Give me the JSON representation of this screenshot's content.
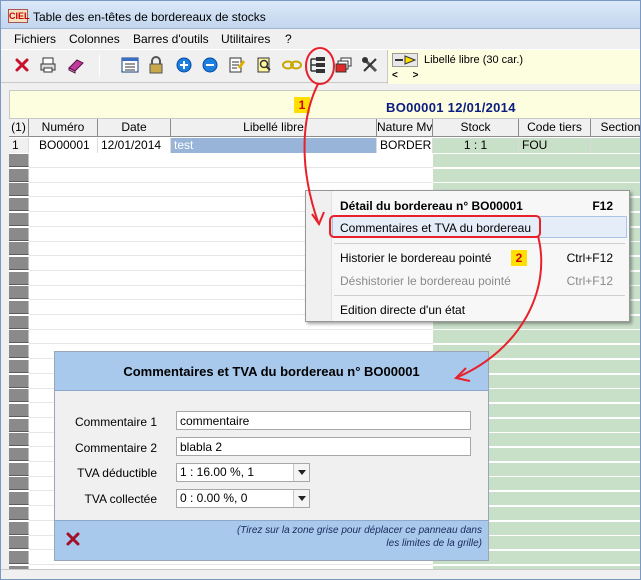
{
  "window": {
    "title": "Table des en-têtes de bordereaux de stocks",
    "app_badge": "CIEL"
  },
  "menu": [
    "Fichiers",
    "Colonnes",
    "Barres d'outils",
    "Utilitaires",
    "?"
  ],
  "libelle": {
    "label": "Libellé libre (30 car.)",
    "arrows": "< >"
  },
  "banner": {
    "text": "BO00001  12/01/2014"
  },
  "markers": {
    "one": "1",
    "two": "2"
  },
  "grid": {
    "columns": [
      "(1)",
      "Numéro",
      "Date",
      "Libellé libre",
      "Nature Mv",
      "Stock",
      "Code tiers",
      "Section"
    ],
    "row": {
      "idx": "1",
      "numero": "BO00001",
      "date": "12/01/2014",
      "libelle": "test",
      "nature": "BORDER",
      "stock": "1 : 1",
      "tiers": "FOU"
    }
  },
  "context_menu": {
    "detail": {
      "label": "Détail du bordereau n° BO00001",
      "key": "F12"
    },
    "comments": {
      "label": "Commentaires et TVA du bordereau"
    },
    "historier": {
      "label": "Historier le bordereau pointé",
      "key": "Ctrl+F12"
    },
    "deshistorier": {
      "label": "Déshistorier le bordereau pointé",
      "key": "Ctrl+F12"
    },
    "edition": {
      "label": "Edition directe d'un état"
    }
  },
  "panel": {
    "title": "Commentaires et TVA du bordereau n° BO00001",
    "comment1": {
      "label": "Commentaire 1",
      "value": "commentaire"
    },
    "comment2": {
      "label": "Commentaire 2",
      "value": "blabla 2"
    },
    "tva_deductible": {
      "label": "TVA déductible",
      "value": "1 : 16.00 %, 1"
    },
    "tva_collectee": {
      "label": "TVA collectée",
      "value": "0 : 0.00 %, 0"
    },
    "note": "(Tirez sur la zone grise pour déplacer ce panneau dans les limites de la grille)"
  },
  "colors": {
    "accent_red": "#e8202a",
    "title_blue": "#0a1d80",
    "grid_green": "#c8dfc8",
    "banner_yellow": "#fdfde0",
    "panel_blue": "#a8c8ec"
  }
}
